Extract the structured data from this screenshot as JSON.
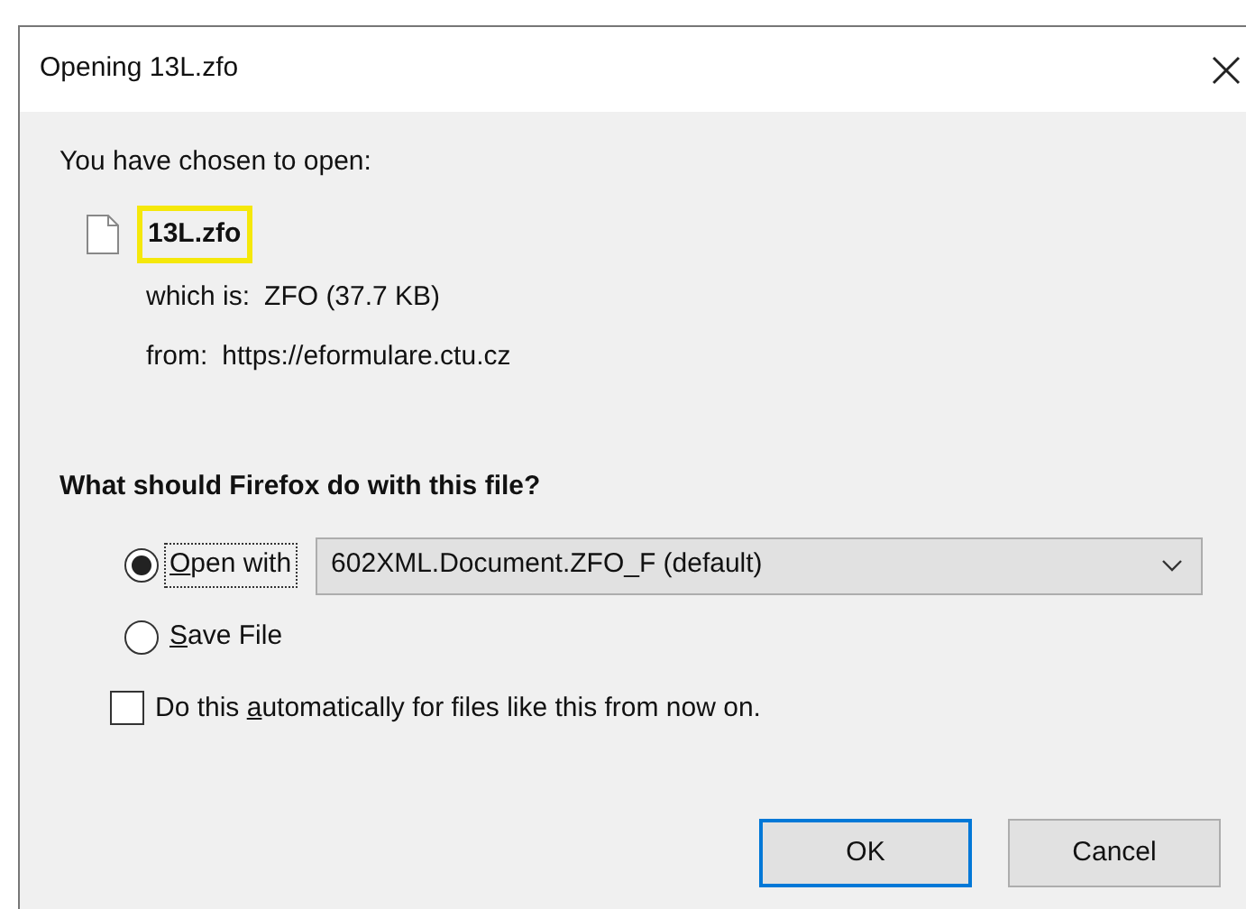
{
  "window": {
    "title": "Opening 13L.zfo"
  },
  "intro": "You have chosen to open:",
  "file": {
    "name": "13L.zfo",
    "highlighted": true
  },
  "details": [
    {
      "label": "which is:",
      "value": "ZFO (37.7 KB)"
    },
    {
      "label": "from:",
      "value": "https://eformulare.ctu.cz"
    }
  ],
  "question": "What should Firefox do with this file?",
  "options": [
    {
      "label_parts": {
        "key": "O",
        "after": "pen with"
      },
      "selected": true,
      "focused": true
    },
    {
      "label_parts": {
        "key": "S",
        "after": "ave File"
      },
      "selected": false,
      "focused": false
    }
  ],
  "application": {
    "value": "602XML.Document.ZFO_F (default)"
  },
  "remember": {
    "label_parts": {
      "before": "Do this ",
      "key": "a",
      "after": "utomatically for files like this from now on."
    },
    "checked": false
  },
  "buttons": [
    {
      "label": "OK",
      "default": true
    },
    {
      "label": "Cancel",
      "default": false
    }
  ]
}
